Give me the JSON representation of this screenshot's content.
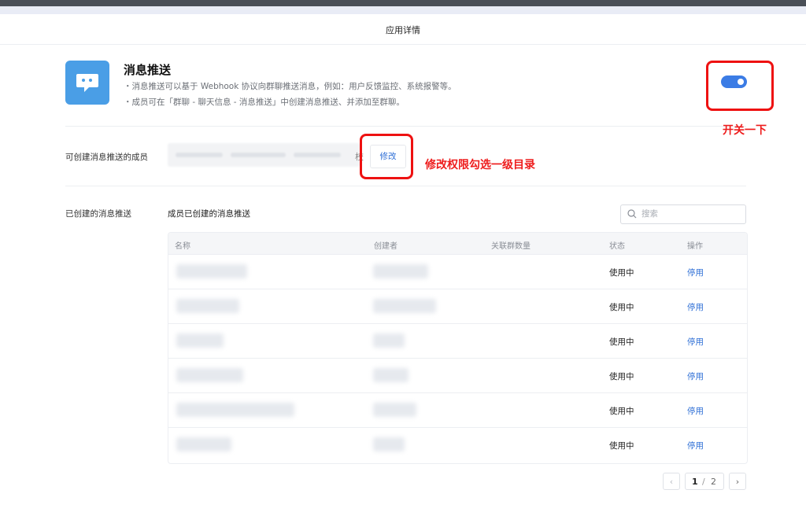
{
  "header": {
    "title": "应用详情"
  },
  "app": {
    "name": "消息推送",
    "icon": "chat-bubble-icon",
    "icon_color": "#4a9ee6",
    "descriptions": [
      "・消息推送可以基于 Webhook 协议向群聊推送消息，例如：用户反馈监控、系统报警等。",
      "・成员可在「群聊 - 聊天信息 - 消息推送」中创建消息推送、并添加至群聊。"
    ],
    "enabled": true
  },
  "permissions": {
    "label": "可创建消息推送的成员",
    "members_tail": "校",
    "edit_label": "修改"
  },
  "created": {
    "label": "已创建的消息推送",
    "section_title": "成员已创建的消息推送",
    "search_placeholder": "搜索",
    "columns": [
      "名称",
      "创建者",
      "关联群数量",
      "状态",
      "操作"
    ],
    "rows": [
      {
        "status": "使用中",
        "action": "停用"
      },
      {
        "status": "使用中",
        "action": "停用"
      },
      {
        "status": "使用中",
        "action": "停用"
      },
      {
        "status": "使用中",
        "action": "停用"
      },
      {
        "status": "使用中",
        "action": "停用"
      },
      {
        "status": "使用中",
        "action": "停用"
      }
    ]
  },
  "pagination": {
    "current": "1",
    "separator": "/",
    "total": "2",
    "prev": "‹",
    "next": "›"
  },
  "annotations": {
    "toggle_note": "开关一下",
    "edit_note": "修改权限勾选一级目录",
    "color": "#ee1111"
  }
}
